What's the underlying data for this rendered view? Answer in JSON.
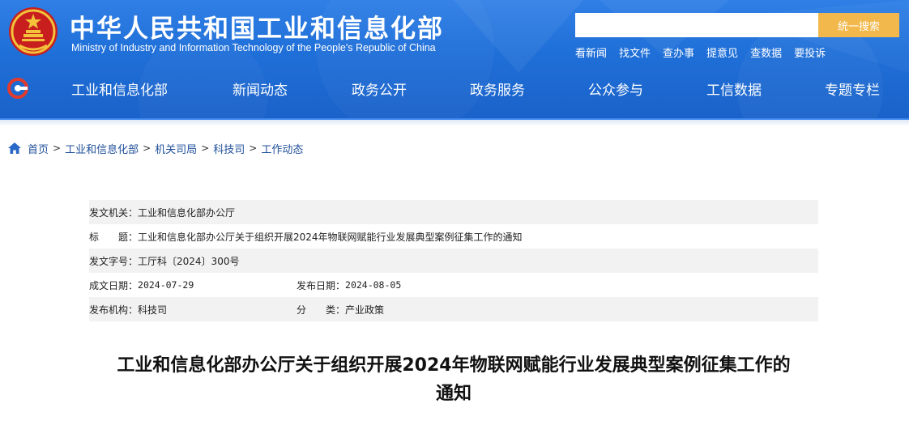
{
  "header": {
    "title_cn": "中华人民共和国工业和信息化部",
    "title_en": "Ministry of Industry and Information Technology of the People's Republic of China",
    "search": {
      "placeholder": "",
      "button_label": "统一搜索"
    },
    "quick_links": [
      "看新闻",
      "找文件",
      "查办事",
      "提意见",
      "查数据",
      "要投诉"
    ]
  },
  "nav": {
    "items": [
      "工业和信息化部",
      "新闻动态",
      "政务公开",
      "政务服务",
      "公众参与",
      "工信数据",
      "专题专栏"
    ]
  },
  "breadcrumb": [
    "首页",
    "工业和信息化部",
    "机关司局",
    "科技司",
    "工作动态"
  ],
  "breadcrumb_sep": ">",
  "meta": {
    "issuer_label": "发文机关：",
    "issuer": "工业和信息化部办公厅",
    "title_label": "标　　题：",
    "title": "工业和信息化部办公厅关于组织开展2024年物联网赋能行业发展典型案例征集工作的通知",
    "doc_no_label": "发文字号：",
    "doc_no": "工厅科〔2024〕300号",
    "created_label": "成文日期：",
    "created": "2024-07-29",
    "published_label": "发布日期：",
    "published": "2024-08-05",
    "org_label": "发布机构：",
    "org": "科技司",
    "category_label": "分　　类：",
    "category": "产业政策"
  },
  "article": {
    "title_line1": "工业和信息化部办公厅关于组织开展2024年物联网赋能行业发展典型案例征集工作的",
    "title_line2": "通知"
  },
  "colors": {
    "header_blue": "#1f6fd8",
    "search_button": "#f2b84b",
    "breadcrumb_link": "#1f4f9a",
    "row_shade": "#f2f2f2"
  },
  "icons": {
    "emblem": "national-emblem-icon",
    "nav_logo": "miit-logo-icon",
    "home": "home-icon"
  }
}
